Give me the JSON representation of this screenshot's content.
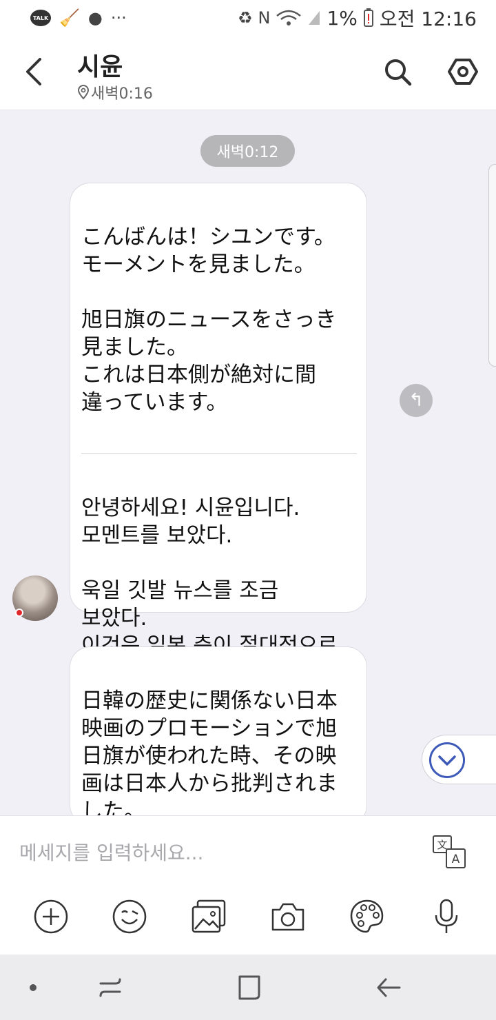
{
  "status_bar": {
    "notifications": [
      "talk-icon",
      "broom-icon",
      "chat-bubble-icon",
      "more-dots"
    ],
    "battery": "1%",
    "time": "오전 12:16"
  },
  "header": {
    "title": "시윤",
    "subtitle": "새벽0:16"
  },
  "chat": {
    "date_chip": "새벽0:12",
    "messages": [
      {
        "original": "こんばんは！シユンです。\nモーメントを見ました。\n\n旭日旗のニュースをさっき\n見ました。\nこれは日本側が絶対に間\n違っています。",
        "translation": "안녕하세요! 시윤입니다.\n모멘트를 보았다.\n\n욱일 깃발 뉴스를 조금\n보았다.\n이것은 일본 측이 절대적으로\n잘못된 것입니다."
      },
      {
        "original": "日韓の歴史に関係ない日本\n映画のプロモーションで旭\n日旗が使われた時、その映\n画は日本人から批判されま\nした。"
      }
    ]
  },
  "input": {
    "placeholder": "메세지를 입력하세요..."
  },
  "colors": {
    "background": "#f1f0f6",
    "accent": "#3d5ab8",
    "chip": "#b6b6b9"
  }
}
